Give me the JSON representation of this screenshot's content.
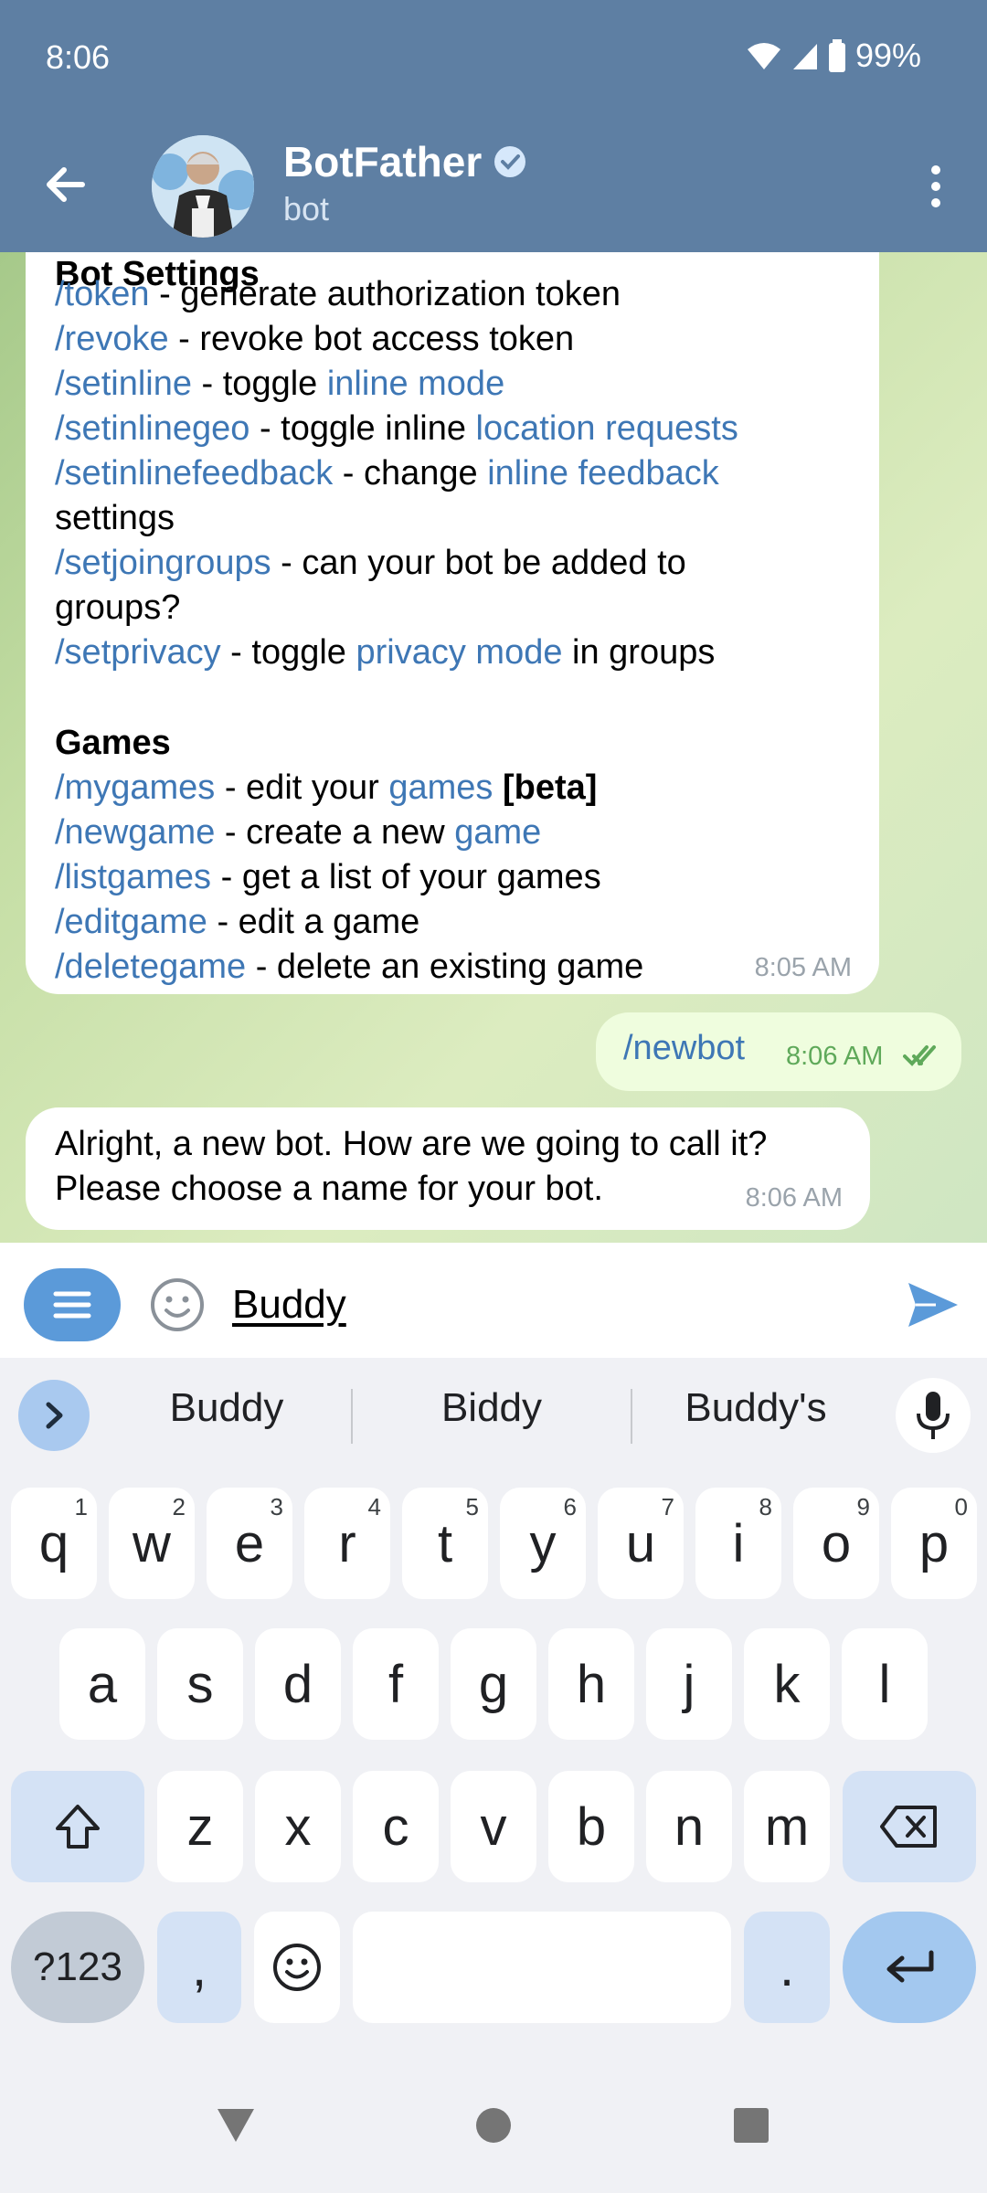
{
  "status": {
    "time": "8:06",
    "battery": "99%"
  },
  "header": {
    "title": "BotFather",
    "subtitle": "bot"
  },
  "messages": {
    "help": {
      "partial_heading": "Bot Settings",
      "lines": [
        {
          "cmd": "/token",
          "text": " - generate authorization token"
        },
        {
          "cmd": "/revoke",
          "text": " - revoke bot access token"
        },
        {
          "cmd": "/setinline",
          "text": " - toggle ",
          "link": "inline mode"
        },
        {
          "cmd": "/setinlinegeo",
          "text": " - toggle inline ",
          "link": "location requests"
        },
        {
          "cmd": "/setinlinefeedback",
          "text": " - change ",
          "link": "inline feedback"
        },
        {
          "plain": "settings"
        },
        {
          "cmd": "/setjoingroups",
          "text": " - can your bot be added to"
        },
        {
          "plain": "groups?"
        },
        {
          "cmd": "/setprivacy",
          "text": " - toggle ",
          "link": "privacy mode",
          "after": " in groups"
        }
      ],
      "games_heading": "Games",
      "games": [
        {
          "cmd": "/mygames",
          "text": " - edit your ",
          "link": "games",
          "bold": " [beta]"
        },
        {
          "cmd": "/newgame",
          "text": " - create a new ",
          "link": "game"
        },
        {
          "cmd": "/listgames",
          "text": " - get a list of your games"
        },
        {
          "cmd": "/editgame",
          "text": " - edit a game"
        },
        {
          "cmd": "/deletegame",
          "text": " - delete an existing game"
        }
      ],
      "time": "8:05 AM"
    },
    "outgoing": {
      "text": "/newbot",
      "time": "8:06 AM"
    },
    "reply": {
      "line1": "Alright, a new bot. How are we going to call it?",
      "line2": "Please choose a name for your bot.",
      "time": "8:06 AM"
    }
  },
  "input": {
    "value": "Buddy"
  },
  "suggestions": [
    "Buddy",
    "Biddy",
    "Buddy's"
  ],
  "keyboard": {
    "row1": [
      [
        "q",
        "1"
      ],
      [
        "w",
        "2"
      ],
      [
        "e",
        "3"
      ],
      [
        "r",
        "4"
      ],
      [
        "t",
        "5"
      ],
      [
        "y",
        "6"
      ],
      [
        "u",
        "7"
      ],
      [
        "i",
        "8"
      ],
      [
        "o",
        "9"
      ],
      [
        "p",
        "0"
      ]
    ],
    "row2": [
      "a",
      "s",
      "d",
      "f",
      "g",
      "h",
      "j",
      "k",
      "l"
    ],
    "row3": [
      "z",
      "x",
      "c",
      "v",
      "b",
      "n",
      "m"
    ],
    "symbols_label": "?123",
    "comma": ",",
    "period": "."
  },
  "colors": {
    "header": "#5e7fa3",
    "link": "#3e77b5",
    "outgoing_bubble": "#effdde",
    "read_check": "#5fa95a"
  },
  "icons": [
    "back-arrow-icon",
    "verified-badge-icon",
    "more-vertical-icon",
    "bot-menu-icon",
    "emoji-icon",
    "send-icon",
    "expand-icon",
    "mic-icon",
    "shift-icon",
    "backspace-icon",
    "enter-icon",
    "nav-back-icon",
    "nav-home-icon",
    "nav-recents-icon"
  ]
}
